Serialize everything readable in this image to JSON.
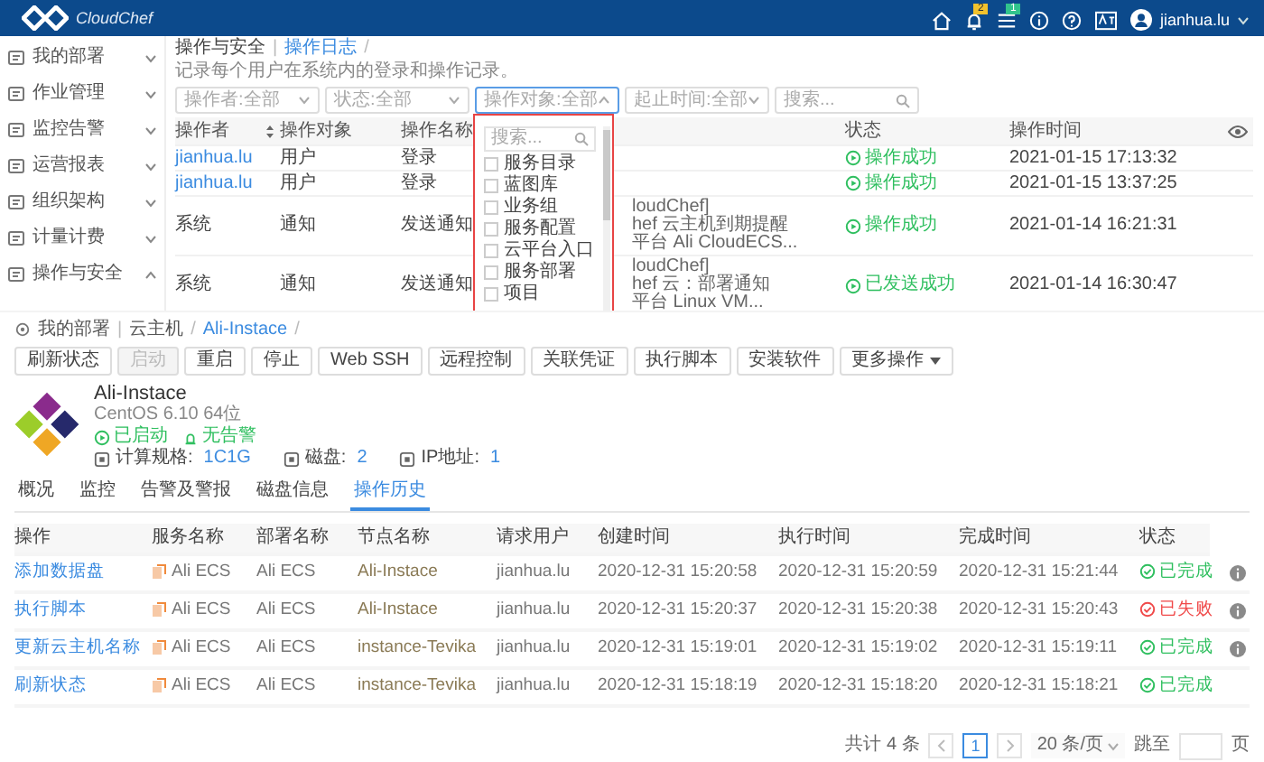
{
  "header": {
    "logo_text": "CloudChef",
    "notifications_badge": "2",
    "tasks_badge": "1",
    "user": "jianhua.lu"
  },
  "sidebar": {
    "items": [
      {
        "label": "我的部署",
        "expanded": false
      },
      {
        "label": "作业管理",
        "expanded": false
      },
      {
        "label": "监控告警",
        "expanded": false
      },
      {
        "label": "运营报表",
        "expanded": false
      },
      {
        "label": "组织架构",
        "expanded": false
      },
      {
        "label": "计量计费",
        "expanded": false
      },
      {
        "label": "操作与安全",
        "expanded": true
      }
    ]
  },
  "audit": {
    "breadcrumb": [
      {
        "label": "操作与安全",
        "separator": "|"
      },
      {
        "label": "操作日志",
        "separator": "/"
      }
    ],
    "description": "记录每个用户在系统内的登录和操作记录。",
    "filters": [
      {
        "placeholder": "操作者:全部",
        "open": false
      },
      {
        "placeholder": "状态:全部",
        "open": false
      },
      {
        "placeholder": "操作对象:全部",
        "open": true
      },
      {
        "placeholder": "起止时间:全部",
        "open": false
      }
    ],
    "search": {
      "placeholder": "搜索..."
    },
    "dropdown": {
      "search_placeholder": "搜索...",
      "options": [
        {
          "label": "服务目录",
          "checked": false
        },
        {
          "label": "蓝图库",
          "checked": false
        },
        {
          "label": "业务组",
          "checked": false
        },
        {
          "label": "服务配置",
          "checked": false
        },
        {
          "label": "云平台入口",
          "checked": false
        },
        {
          "label": "服务部署",
          "checked": false
        },
        {
          "label": "项目",
          "checked": false
        }
      ]
    },
    "table": {
      "columns": [
        "操作者",
        "操作对象",
        "操作名称",
        "状态",
        "操作时间"
      ],
      "rows": [
        {
          "operator": "jianhua.lu",
          "object": "用户",
          "name": "登录",
          "column_4": [],
          "status": "操作成功",
          "time": "2021-01-15 17:13:32"
        },
        {
          "operator": "jianhua.lu",
          "object": "用户",
          "name": "登录",
          "column_4": [],
          "status": "操作成功",
          "time": "2021-01-15 13:37:25"
        },
        {
          "operator": "系统",
          "object": "通知",
          "name": "发送通知",
          "column_4": [
            "loudChef]",
            "hef 云主机到期提醒",
            "平台 Ali CloudECS..."
          ],
          "status": "操作成功",
          "time": "2021-01-14 16:21:31"
        },
        {
          "operator": "系统",
          "object": "通知",
          "name": "发送通知",
          "column_4": [
            "loudChef]",
            "hef 云：部署通知",
            "平台 Linux VM..."
          ],
          "status": "已发送成功",
          "time": "2021-01-14 16:30:47"
        }
      ]
    }
  },
  "instance": {
    "breadcrumb": [
      {
        "label": "我的部署",
        "separator": "|"
      },
      {
        "label": "云主机",
        "separator": "/"
      },
      {
        "label": "Ali-Instace",
        "separator": "/"
      }
    ],
    "buttons": [
      {
        "label": "刷新状态",
        "disabled": false
      },
      {
        "label": "启动",
        "disabled": true
      },
      {
        "label": "重启",
        "disabled": false
      },
      {
        "label": "停止",
        "disabled": false
      },
      {
        "label": "Web SSH",
        "disabled": false
      },
      {
        "label": "远程控制",
        "disabled": false
      },
      {
        "label": "关联凭证",
        "disabled": false
      },
      {
        "label": "执行脚本",
        "disabled": false
      },
      {
        "label": "安装软件",
        "disabled": false
      },
      {
        "label": "更多操作",
        "disabled": false
      }
    ],
    "title": "Ali-Instace",
    "os": "CentOS 6.10 64位",
    "power": "已启动",
    "alerts": "无告警",
    "specs": [
      {
        "label": "计算规格:",
        "value": "1C1G"
      },
      {
        "label": "磁盘:",
        "value": "2"
      },
      {
        "label": "IP地址:",
        "value": "1"
      }
    ],
    "tabs": [
      {
        "label": "概况",
        "selected": false
      },
      {
        "label": "监控",
        "selected": false
      },
      {
        "label": "告警及警报",
        "selected": false
      },
      {
        "label": "磁盘信息",
        "selected": false
      },
      {
        "label": "操作历史",
        "selected": true
      }
    ],
    "table": {
      "columns": [
        "操作",
        "服务名称",
        "部署名称",
        "节点名称",
        "请求用户",
        "创建时间",
        "执行时间",
        "完成时间",
        "状态"
      ],
      "rows": [
        {
          "operation": "添加数据盘",
          "service": "Ali ECS",
          "deployment": "Ali ECS",
          "node": "Ali-Instace",
          "user": "jianhua.lu",
          "created": "2020-12-31 15:20:58",
          "executed": "2020-12-31 15:20:59",
          "finished": "2020-12-31 15:21:44",
          "status": "已完成",
          "color": "#2fbf5f",
          "info": true
        },
        {
          "operation": "执行脚本",
          "service": "Ali ECS",
          "deployment": "Ali ECS",
          "node": "Ali-Instace",
          "user": "jianhua.lu",
          "created": "2020-12-31 15:20:37",
          "executed": "2020-12-31 15:20:38",
          "finished": "2020-12-31 15:20:43",
          "status": "已失败",
          "color": "#f04a4a",
          "info": true
        },
        {
          "operation": "更新云主机名称",
          "service": "Ali ECS",
          "deployment": "Ali ECS",
          "node": "instance-Tevika",
          "user": "jianhua.lu",
          "created": "2020-12-31 15:19:01",
          "executed": "2020-12-31 15:19:02",
          "finished": "2020-12-31 15:19:11",
          "status": "已完成",
          "color": "#2fbf5f",
          "info": true
        },
        {
          "operation": "刷新状态",
          "service": "Ali ECS",
          "deployment": "Ali ECS",
          "node": "instance-Tevika",
          "user": "jianhua.lu",
          "created": "2020-12-31 15:18:19",
          "executed": "2020-12-31 15:18:20",
          "finished": "2020-12-31 15:18:21",
          "status": "已完成",
          "color": "#2fbf5f",
          "info": false
        }
      ]
    },
    "pagination": {
      "total": "共计 4 条",
      "pages": [
        {
          "label": "1",
          "selected": true
        }
      ],
      "page_size": "20 条/页",
      "jump_label": "跳至",
      "jump_suffix": "页"
    }
  }
}
